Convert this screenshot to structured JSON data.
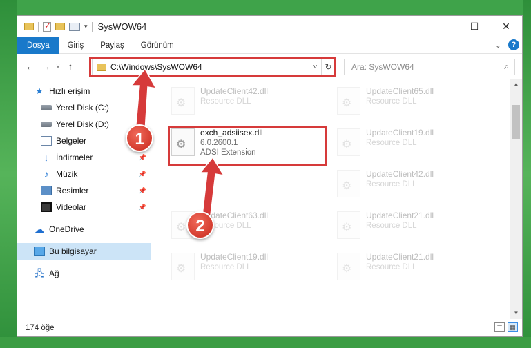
{
  "window": {
    "title": "SysWOW64",
    "controls": {
      "minimize": "—",
      "maximize": "☐",
      "close": "✕"
    }
  },
  "ribbon": {
    "tabs": [
      "Dosya",
      "Giriş",
      "Paylaş",
      "Görünüm"
    ],
    "collapse_icon": "chevron-down-icon",
    "help_label": "?"
  },
  "nav": {
    "back": "←",
    "forward": "→",
    "recent": "˅",
    "up": "↑",
    "address_path": "C:\\Windows\\SysWOW64",
    "address_dropdown": "˅",
    "refresh": "↻",
    "search_placeholder": "Ara: SysWOW64",
    "search_icon": "⌕"
  },
  "sidebar": {
    "quick_access": "Hızlı erişim",
    "items": [
      {
        "label": "Yerel Disk (C:)",
        "icon": "drive-icon",
        "pinned": true
      },
      {
        "label": "Yerel Disk (D:)",
        "icon": "drive-icon",
        "pinned": true
      },
      {
        "label": "Belgeler",
        "icon": "documents-icon",
        "pinned": true
      },
      {
        "label": "İndirmeler",
        "icon": "download-icon",
        "pinned": true
      },
      {
        "label": "Müzik",
        "icon": "music-icon",
        "pinned": true
      },
      {
        "label": "Resimler",
        "icon": "pictures-icon",
        "pinned": true
      },
      {
        "label": "Videolar",
        "icon": "videos-icon",
        "pinned": true
      }
    ],
    "onedrive": "OneDrive",
    "this_pc": "Bu bilgisayar",
    "network": "Ağ",
    "pin_glyph": "📌"
  },
  "files": {
    "left_column": [
      {
        "name": "UpdateClient42.dll",
        "type": "Resource DLL"
      },
      {
        "name": "exch_adsiisex.dll",
        "version": "6.0.2600.1",
        "type": "ADSI Extension"
      },
      {
        "name": "UpdateClient63.dll",
        "type": "Resource DLL"
      },
      {
        "name": "UpdateClient19.dll",
        "type": "Resource DLL"
      }
    ],
    "right_column": [
      {
        "name": "UpdateClient65.dll",
        "type": "Resource DLL"
      },
      {
        "name": "UpdateClient19.dll",
        "type": "Resource DLL"
      },
      {
        "name": "UpdateClient42.dll",
        "type": "Resource DLL"
      },
      {
        "name": "UpdateClient21.dll",
        "type": "Resource DLL"
      },
      {
        "name": "UpdateClient21.dll",
        "type": "Resource DLL"
      }
    ]
  },
  "status": {
    "count": "174 öğe"
  },
  "annotations": {
    "step1": "1",
    "step2": "2",
    "highlight_color": "#d63a3a"
  }
}
